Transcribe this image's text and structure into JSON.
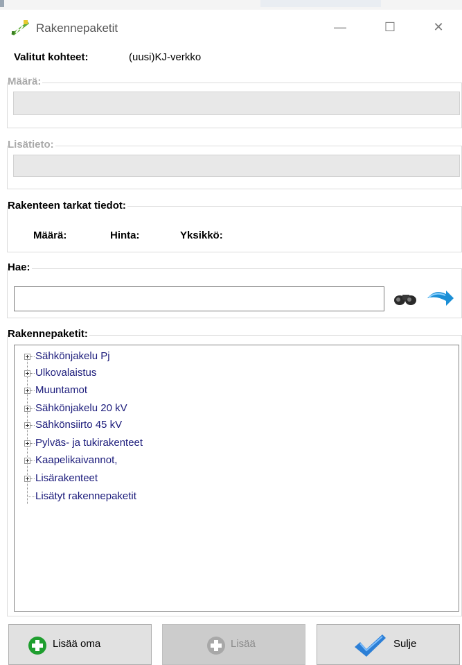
{
  "window": {
    "title": "Rakennepaketit",
    "minimize_glyph": "—",
    "maximize_glyph": "☐",
    "close_glyph": "✕"
  },
  "selected": {
    "label": "Valitut kohteet:",
    "value": "(uusi)KJ-verkko"
  },
  "maara_group": {
    "legend": "Määrä:"
  },
  "lisatieto_group": {
    "legend": "Lisätieto:"
  },
  "details_group": {
    "legend": "Rakenteen tarkat tiedot:",
    "maara_label": "Määrä:",
    "hinta_label": "Hinta:",
    "yksikko_label": "Yksikkö:"
  },
  "search_group": {
    "legend": "Hae:",
    "value": ""
  },
  "tree_group": {
    "legend": "Rakennepaketit:",
    "items": [
      "Sähkönjakelu Pj",
      "Ulkovalaistus",
      "Muuntamot",
      "Sähkönjakelu 20 kV",
      "Sähkönsiirto 45 kV",
      "Pylväs- ja tukirakenteet",
      "Kaapelikaivannot,",
      "Lisärakenteet",
      "Lisätyt rakennepaketit"
    ]
  },
  "buttons": {
    "add_own": "Lisää oma",
    "add": "Lisää",
    "close": "Sulje"
  },
  "icons": {
    "app": "structure-icon",
    "search": "binoculars-icon",
    "refresh": "arrow-icon",
    "add_own": "plus-circle-icon",
    "add": "plus-circle-icon",
    "close": "checkmark-icon"
  },
  "colors": {
    "tree_text": "#1a1a7a",
    "add_green": "#1f9e2f",
    "check_blue": "#2c7fd6",
    "disabled_text": "#a9a9a9"
  }
}
